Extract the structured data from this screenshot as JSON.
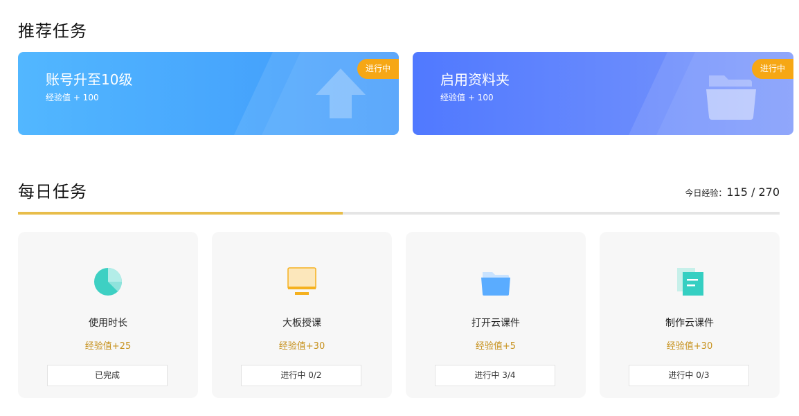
{
  "recommended": {
    "title": "推荐任务",
    "cards": [
      {
        "name": "账号升至10级",
        "exp": "经验值 + 100",
        "status": "进行中",
        "icon": "upload-arrow-icon",
        "color_from": "#52b7ff",
        "color_to": "#3f98fb"
      },
      {
        "name": "启用资料夹",
        "exp": "经验值 + 100",
        "status": "进行中",
        "icon": "folder-icon",
        "color_from": "#5079ff",
        "color_to": "#7b97fb"
      }
    ]
  },
  "daily": {
    "title": "每日任务",
    "today_label": "今日经验：",
    "today_value": "115 / 270",
    "progress_fraction": 0.426,
    "progress_color": "#e8bd4a",
    "tasks": [
      {
        "name": "使用时长",
        "exp": "经验值+25",
        "status": "已完成",
        "icon": "pie-chart-icon"
      },
      {
        "name": "大板授课",
        "exp": "经验值+30",
        "status": "进行中 0/2",
        "icon": "monitor-icon"
      },
      {
        "name": "打开云课件",
        "exp": "经验值+5",
        "status": "进行中 3/4",
        "icon": "folder-icon"
      },
      {
        "name": "制作云课件",
        "exp": "经验值+30",
        "status": "进行中 0/3",
        "icon": "document-icon"
      }
    ]
  }
}
